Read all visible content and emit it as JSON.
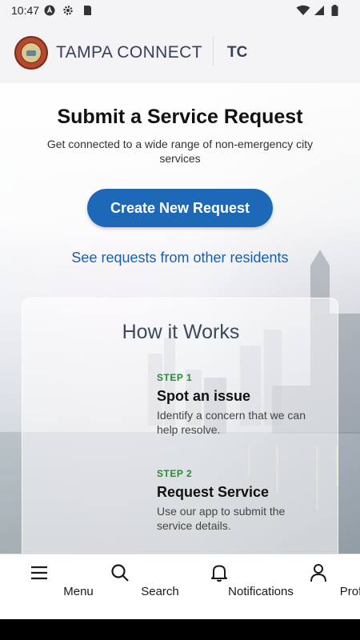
{
  "status_bar": {
    "time": "10:47",
    "icons": [
      "a-app-icon",
      "settings-gear-icon",
      "sd-card-icon",
      "wifi-icon",
      "signal-icon",
      "battery-icon"
    ]
  },
  "header": {
    "logo": "city-seal-logo",
    "brand_name": "TAMPA CONNECT",
    "brand_abbr": "TC"
  },
  "main": {
    "title": "Submit a Service Request",
    "subtitle": "Get connected to a wide range of non-emergency city services",
    "create_button": "Create New Request",
    "other_requests_link": "See requests from other residents"
  },
  "how_it_works": {
    "title": "How it Works",
    "steps": [
      {
        "label": "STEP 1",
        "title": "Spot an issue",
        "description": "Identify a concern that we can help resolve."
      },
      {
        "label": "STEP 2",
        "title": "Request Service",
        "description": "Use our app to submit the service details."
      }
    ]
  },
  "bottom_nav": {
    "items": [
      {
        "label": "Menu",
        "icon": "menu-icon"
      },
      {
        "label": "Search",
        "icon": "search-icon"
      },
      {
        "label": "Notifications",
        "icon": "bell-icon"
      },
      {
        "label": "Profile",
        "icon": "person-icon"
      }
    ]
  },
  "colors": {
    "primary": "#1e68b8",
    "link": "#1a5fae",
    "step_label": "#2d8a3a",
    "brand_text": "#3a3f58"
  }
}
